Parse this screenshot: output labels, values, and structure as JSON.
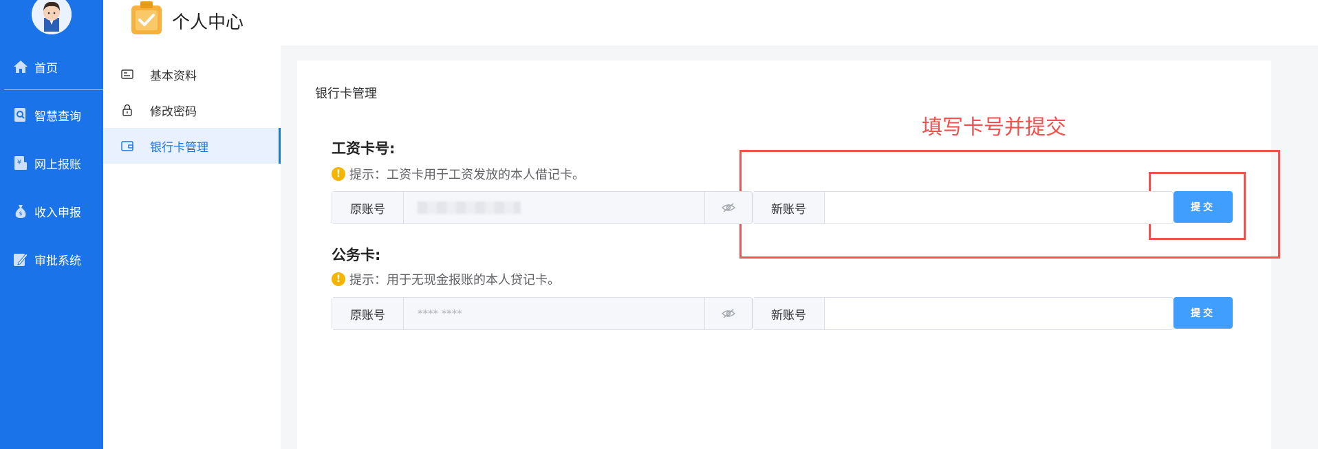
{
  "sidebar": {
    "items": [
      {
        "label": "首页",
        "icon": "home-icon"
      },
      {
        "label": "智慧查询",
        "icon": "search-doc-icon"
      },
      {
        "label": "网上报账",
        "icon": "yen-doc-icon"
      },
      {
        "label": "收入申报",
        "icon": "money-bag-icon"
      },
      {
        "label": "审批系统",
        "icon": "approval-pen-icon"
      }
    ]
  },
  "header": {
    "title": "个人中心",
    "logo_icon": "clipboard-check-icon"
  },
  "subnav": {
    "items": [
      {
        "label": "基本资料",
        "icon": "id-card-icon"
      },
      {
        "label": "修改密码",
        "icon": "lock-icon"
      },
      {
        "label": "银行卡管理",
        "icon": "wallet-icon",
        "active": true
      }
    ]
  },
  "main": {
    "card_title": "银行卡管理",
    "annotation": "填写卡号并提交",
    "sections": [
      {
        "heading": "工资卡号:",
        "hint": "提示：工资卡用于工资发放的本人借记卡。",
        "old_label": "原账号",
        "old_value": "",
        "new_label": "新账号",
        "new_value": "",
        "submit_label": "提交"
      },
      {
        "heading": "公务卡:",
        "hint": "提示：用于无现金报账的本人贷记卡。",
        "old_label": "原账号",
        "old_value": "**** ****",
        "new_label": "新账号",
        "new_value": "",
        "submit_label": "提交"
      }
    ]
  },
  "colors": {
    "sidebar": "#1a73e8",
    "primary_button": "#409eff",
    "annotation": "#f0524f",
    "warning": "#f5b400"
  }
}
